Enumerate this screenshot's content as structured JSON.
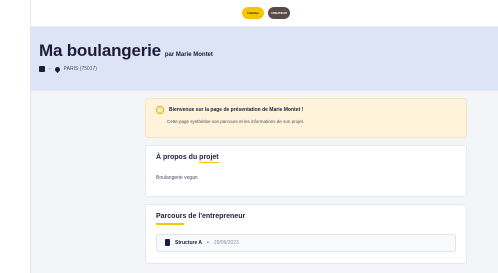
{
  "header": {
    "logo_left_text": "Initiative",
    "logo_right_text": "CREATEUR"
  },
  "hero": {
    "title": "Ma boulangerie",
    "author": "par Marie Montet",
    "meta_dash": "-",
    "location": "PARIS (75017)"
  },
  "notice": {
    "icon": "i",
    "title": "Bienvenue sur la page de présentation de Marie Montet !",
    "text": "Cette page synthétise son parcours et les informations de son projet."
  },
  "about": {
    "title_prefix": "À propos du ",
    "title_accent": "projet",
    "body": "Boulangerie vegan"
  },
  "parcours": {
    "title": "Parcours de l'entrepreneur",
    "structure_name": "Structure A",
    "separator": "•",
    "structure_date": "29/09/2023"
  },
  "colors": {
    "accent": "#f7c500",
    "hero_bg": "#dde4f6",
    "notice_bg": "#fff4d9",
    "text_dark": "#1d1d3b"
  }
}
